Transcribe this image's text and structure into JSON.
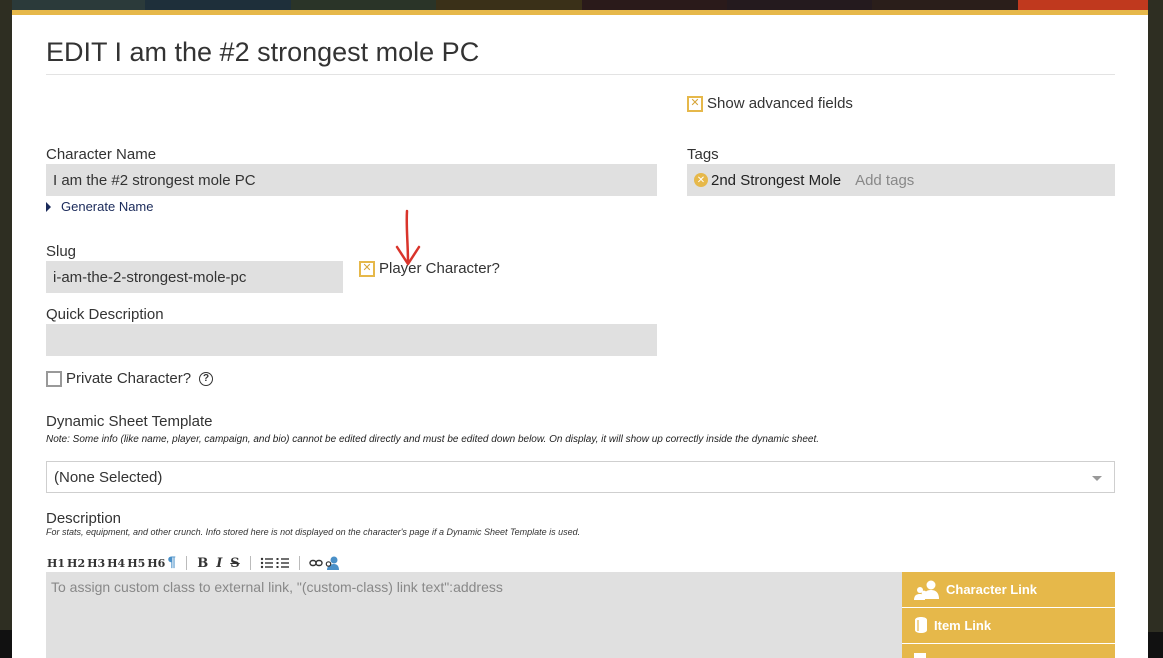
{
  "page": {
    "title": "EDIT I am the #2 strongest mole PC"
  },
  "form": {
    "show_advanced_label": "Show advanced fields",
    "character_name_label": "Character Name",
    "character_name_value": "I am the #2 strongest mole PC",
    "generate_name_label": "Generate Name",
    "tags_label": "Tags",
    "tags": [
      "2nd Strongest Mole"
    ],
    "tags_placeholder": "Add tags",
    "slug_label": "Slug",
    "slug_value": "i-am-the-2-strongest-mole-pc",
    "player_character_label": "Player Character?",
    "quick_description_label": "Quick Description",
    "quick_description_value": "",
    "private_character_label": "Private Character?",
    "help_glyph": "?",
    "dynamic_sheet_label": "Dynamic Sheet Template",
    "dynamic_sheet_note": "Note: Some info (like name, player, campaign, and bio) cannot be edited directly and must be edited down below. On display, it will show up correctly inside the dynamic sheet.",
    "dynamic_sheet_selected": "(None Selected)",
    "description_label": "Description",
    "description_note": "For stats, equipment, and other crunch. Info stored here is not displayed on the character's page if a Dynamic Sheet Template is used.",
    "description_placeholder": "To assign custom class to external link, \"(custom-class) link text\":address"
  },
  "toolbar": {
    "headings": [
      "H1",
      "H2",
      "H3",
      "H4",
      "H5",
      "H6"
    ],
    "pilcrow": "¶",
    "bold": "B",
    "italic": "I",
    "strike": "S"
  },
  "sidebar_buttons": [
    {
      "label": "Character Link",
      "icon": "characters-icon"
    },
    {
      "label": "Item Link",
      "icon": "item-icon"
    }
  ],
  "colors": {
    "accent": "#e6b84a",
    "field_bg": "#e0e0e0",
    "annotation_arrow": "#d9342b"
  }
}
